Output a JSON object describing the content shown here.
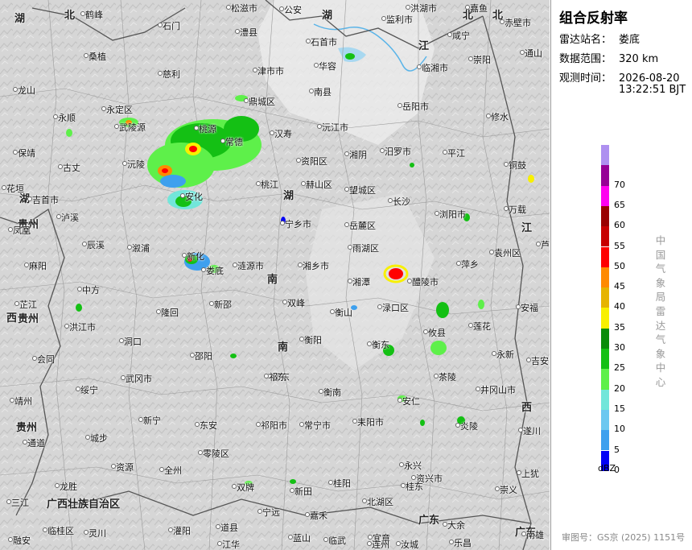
{
  "panel": {
    "title": "组合反射率",
    "station_label": "雷达站名：",
    "station_value": "娄底",
    "range_label": "数据范围：",
    "range_value": "320 km",
    "time_label": "观测时间：",
    "time_date": "2026-08-20",
    "time_clock": "13:22:51 BJT",
    "vertical_text": "中国气象局雷达气象中心",
    "review_no": "审图号：GS京 (2025) 1151号"
  },
  "legend": {
    "unit": "dBZ",
    "bins": [
      {
        "label": "0",
        "color": "#0000f6"
      },
      {
        "label": "5",
        "color": "#3ea0ee"
      },
      {
        "label": "10",
        "color": "#6cc8f0"
      },
      {
        "label": "15",
        "color": "#72e6da"
      },
      {
        "label": "20",
        "color": "#5ef04a"
      },
      {
        "label": "25",
        "color": "#14c014"
      },
      {
        "label": "30",
        "color": "#0a8c0a"
      },
      {
        "label": "35",
        "color": "#f8f000"
      },
      {
        "label": "40",
        "color": "#e6b400"
      },
      {
        "label": "45",
        "color": "#ff8a00"
      },
      {
        "label": "50",
        "color": "#ff0000"
      },
      {
        "label": "55",
        "color": "#c80000"
      },
      {
        "label": "60",
        "color": "#9a0000"
      },
      {
        "label": "65",
        "color": "#ff00f0"
      },
      {
        "label": "70",
        "color": "#960096"
      },
      {
        "label": "",
        "color": "#ae90f0"
      }
    ]
  },
  "map": {
    "provinces": [
      "湖",
      "北",
      "湖",
      "北",
      "北",
      "湖",
      "湖",
      "南",
      "江",
      "西",
      "贵州",
      "贵州",
      "贵州",
      "西",
      "广西壮族自治区",
      "广东",
      "广东",
      "江",
      "南"
    ],
    "cities": [
      "鹤峰",
      "石门",
      "松滋市",
      "公安",
      "监利市",
      "洪湖市",
      "嘉鱼",
      "咸宁",
      "赤壁市",
      "通山",
      "龙山",
      "桑植",
      "慈利",
      "澧县",
      "津市市",
      "石首市",
      "华容",
      "岳阳市",
      "临湘市",
      "崇阳",
      "永顺",
      "永定区",
      "武陵源",
      "鼎城区",
      "汉寿",
      "沅江市",
      "湘阴",
      "汨罗市",
      "平江",
      "修水",
      "保靖",
      "古丈",
      "沅陵",
      "桃源",
      "常德",
      "资阳区",
      "南县",
      "铜鼓",
      "花垣",
      "吉首市",
      "泸溪",
      "安化",
      "桃江",
      "赫山区",
      "望城区",
      "长沙",
      "浏阳市",
      "万载",
      "凤凰",
      "辰溪",
      "溆浦",
      "宁乡市",
      "岳麓区",
      "雨湖区",
      "袁州区",
      "芦溪",
      "麻阳",
      "中方",
      "新化",
      "涟源市",
      "湘乡市",
      "湘潭",
      "醴陵市",
      "萍乡",
      "芷江",
      "洪江市",
      "隆回",
      "新邵",
      "双峰",
      "衡山",
      "渌口区",
      "莲花",
      "安福",
      "会同",
      "洞口",
      "邵阳",
      "邵东",
      "衡阳",
      "衡东",
      "攸县",
      "永新",
      "吉安",
      "靖州",
      "武冈市",
      "祁东",
      "衡南",
      "茶陵",
      "井冈山市",
      "通道",
      "绥宁",
      "新宁",
      "东安",
      "祁阳市",
      "常宁市",
      "耒阳市",
      "安仁",
      "炎陵",
      "遂川",
      "城步",
      "资源",
      "零陵区",
      "桂阳",
      "永兴",
      "资兴市",
      "上犹",
      "全州",
      "双牌",
      "新田",
      "嘉禾",
      "北湖区",
      "桂东",
      "崇义",
      "三江",
      "龙胜",
      "宁远",
      "蓝山",
      "临武",
      "宜章",
      "汝城",
      "大余",
      "融安",
      "临桂区",
      "灵川",
      "灌阳",
      "道县",
      "江华",
      "连州",
      "乐昌",
      "南雄",
      "娄底"
    ]
  }
}
